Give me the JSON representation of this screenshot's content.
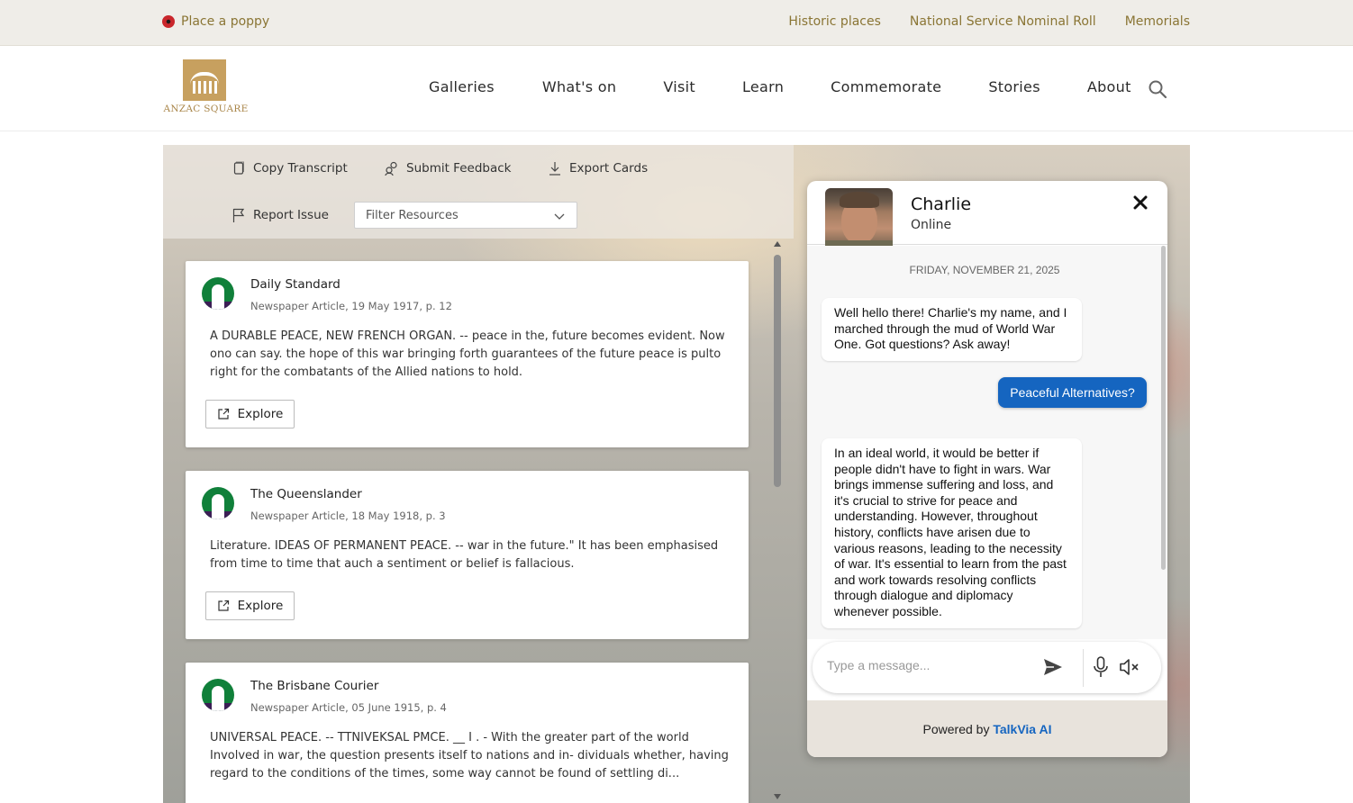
{
  "utility_bar": {
    "poppy_label": "Place a poppy",
    "links": [
      "Historic places",
      "National Service Nominal Roll",
      "Memorials"
    ]
  },
  "brand": {
    "logo_text": "ANZAC SQUARE"
  },
  "nav": {
    "items": [
      "Galleries",
      "What's on",
      "Visit",
      "Learn",
      "Commemorate",
      "Stories",
      "About"
    ]
  },
  "toolbar": {
    "copy_transcript": "Copy Transcript",
    "submit_feedback": "Submit Feedback",
    "export_cards": "Export Cards",
    "report_issue": "Report Issue",
    "filter_placeholder": "Filter Resources"
  },
  "cards": [
    {
      "source": "Daily Standard",
      "meta": "Newspaper Article, 19 May 1917, p. 12",
      "body": "A DURABLE PEACE, NEW FRENCH ORGAN. -- peace in the, future becomes evident. Now ono can say. the hope of this war bringing forth guarantees of the future peace is pulto right for the combatants of the Allied nations to hold.",
      "action": "Explore"
    },
    {
      "source": "The Queenslander",
      "meta": "Newspaper Article, 18 May 1918, p. 3",
      "body": "Literature. IDEAS OF PERMANENT PEACE. -- war in the future.\" It has been emphasised from time to time that auch a sentiment or belief is fallacious.",
      "action": "Explore"
    },
    {
      "source": "The Brisbane Courier",
      "meta": "Newspaper Article, 05 June 1915, p. 4",
      "body": "UNIVERSAL PEACE. -- TTNIVEKSAL PMCE. __ I . - With the greater part of the world Involved in war, the question presents itself to nations and in- dividuals whether, having regard to the conditions of the times, some way cannot be found of settling di...",
      "action": "Explore"
    }
  ],
  "chat": {
    "name": "Charlie",
    "status": "Online",
    "date": "FRIDAY, NOVEMBER 21, 2025",
    "messages": [
      "Well hello there! Charlie's my name, and I marched through the mud of World War One. Got questions? Ask away!",
      "Peaceful Alternatives?",
      "In an ideal world, it would be better if people didn't have to fight in wars. War brings immense suffering and loss, and it's crucial to strive for peace and understanding. However, throughout history, conflicts have arisen due to various reasons, leading to the necessity of war. It's essential to learn from the past and work towards resolving conflicts through dialogue and diplomacy whenever possible."
    ],
    "input_placeholder": "Type a message...",
    "powered_by": "Powered by",
    "powered_brand": "TalkVia AI"
  },
  "colors": {
    "gold": "#8a7534",
    "logo": "#c7a05f",
    "accent_blue": "#1565c0"
  }
}
